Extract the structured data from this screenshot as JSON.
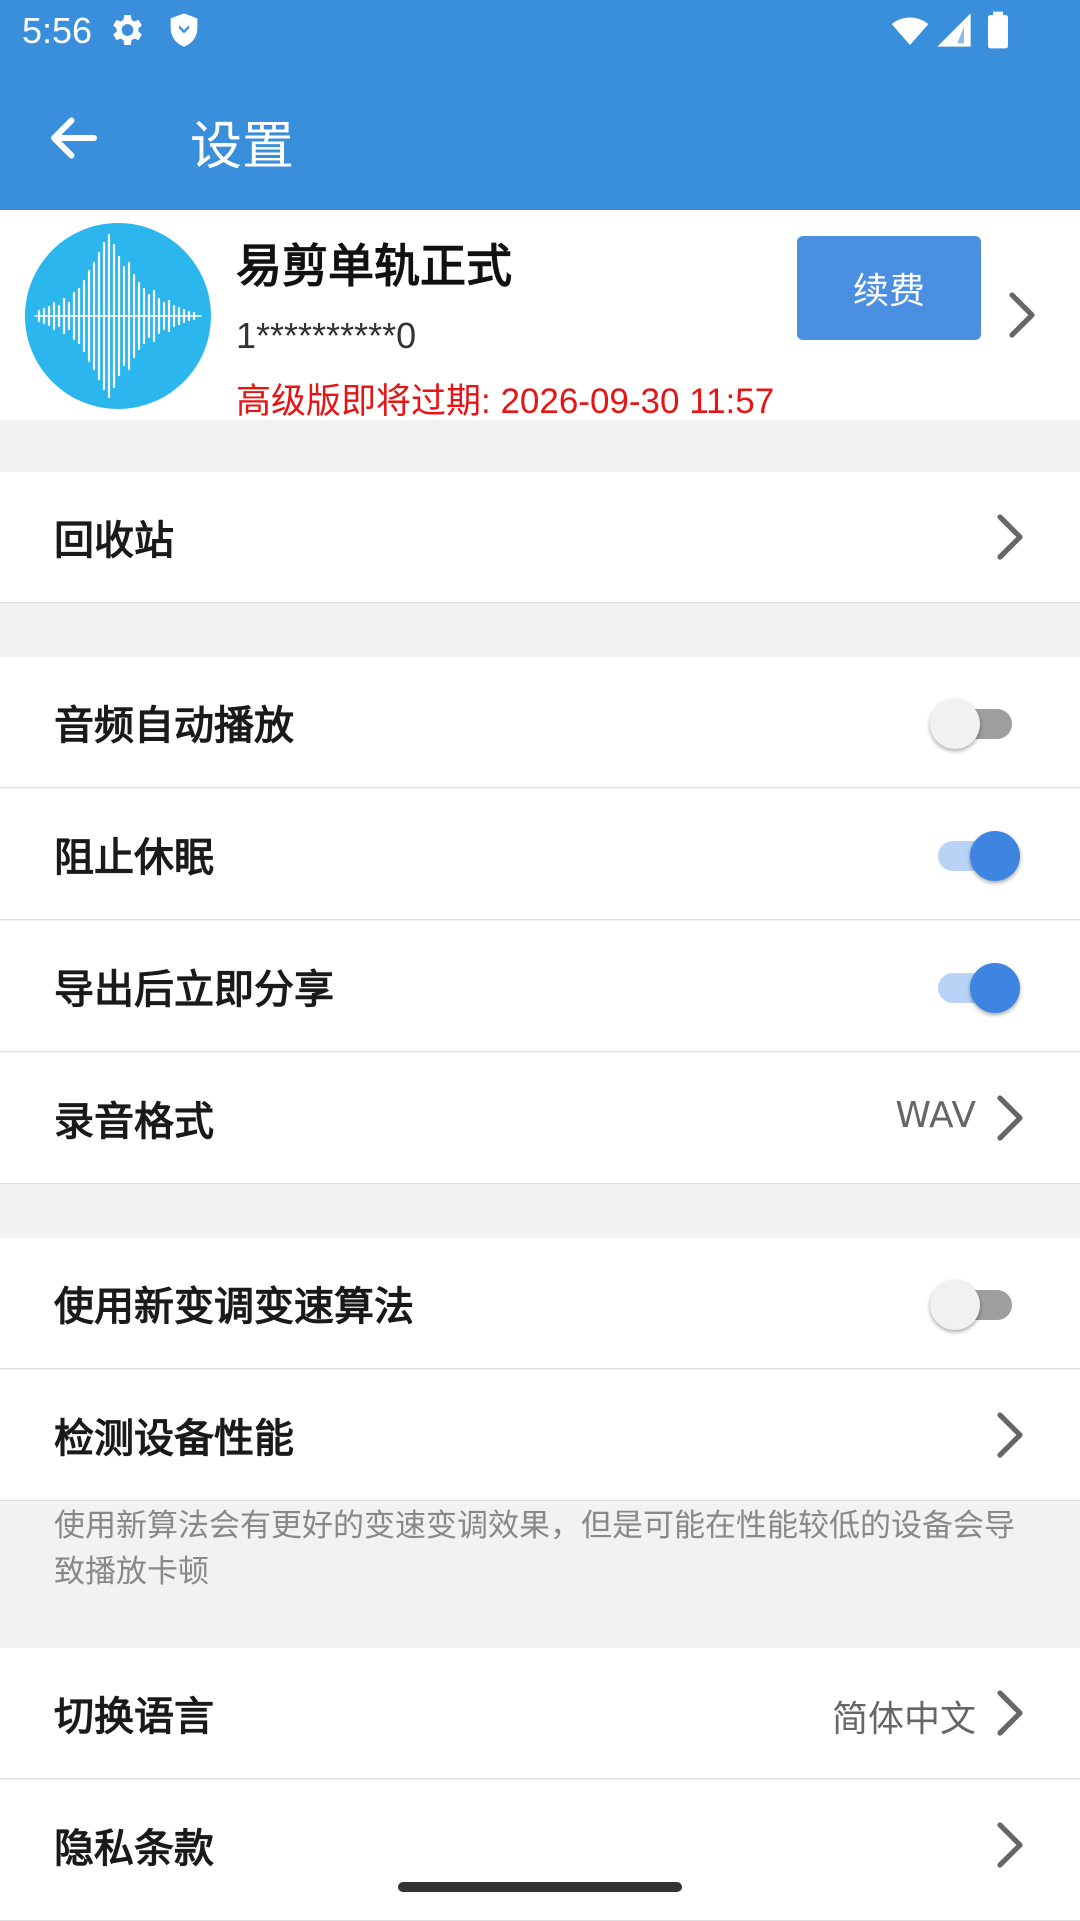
{
  "status_bar": {
    "time": "5:56",
    "icons": [
      "gear-icon",
      "shield-icon",
      "wifi-icon",
      "signal-icon",
      "battery-icon"
    ]
  },
  "app_bar": {
    "title": "设置",
    "back_icon": "arrow-back-icon"
  },
  "account": {
    "name": "易剪单轨正式",
    "phone": "1**********0",
    "expiry": "高级版即将过期: 2026-09-30 11:57",
    "renew_label": "续费",
    "avatar_icon": "sound-wave-icon"
  },
  "settings": {
    "recycle_bin": {
      "label": "回收站"
    },
    "auto_play": {
      "label": "音频自动播放",
      "enabled": false
    },
    "prevent_sleep": {
      "label": "阻止休眠",
      "enabled": true
    },
    "share_after_export": {
      "label": "导出后立即分享",
      "enabled": true
    },
    "record_format": {
      "label": "录音格式",
      "value": "WAV"
    },
    "new_algorithm": {
      "label": "使用新变调变速算法",
      "enabled": false
    },
    "device_perf": {
      "label": "检测设备性能"
    },
    "algorithm_note": "使用新算法会有更好的变速变调效果，但是可能在性能较低的设备会导致播放卡顿",
    "language": {
      "label": "切换语言",
      "value": "简体中文"
    },
    "privacy": {
      "label": "隐私条款"
    }
  },
  "colors": {
    "primary": "#3a8fdc",
    "button": "#4a8fe1",
    "expiry_text": "#e81313",
    "toggle_on": "#3d85e0"
  }
}
